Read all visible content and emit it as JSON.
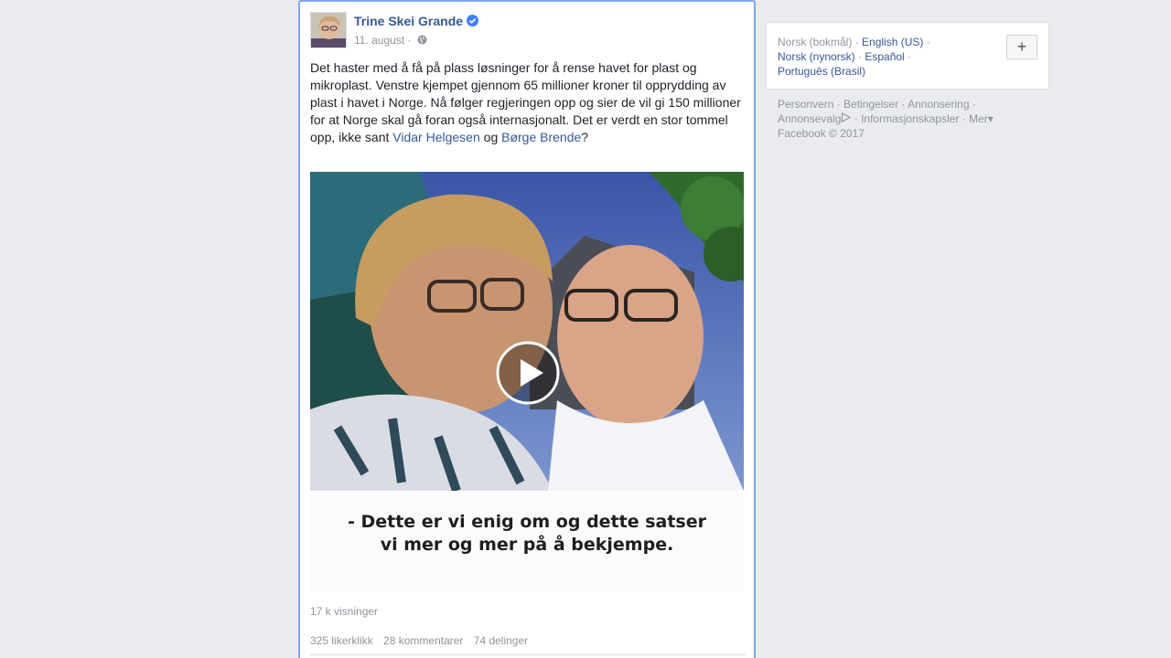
{
  "post": {
    "author": "Trine Skei Grande",
    "date": "11. august",
    "meta_separator": " · ",
    "body_text": "Det haster med å få på plass løsninger for å rense havet for plast og mikroplast. Venstre kjempet gjennom 65 millioner kroner til opprydding av plast i havet i Norge. Nå følger regjeringen opp og sier de vil gi 150 millioner for at Norge skal gå foran også internasjonalt. Det er verdt en stor tommel opp, ikke sant ",
    "mention_1": "Vidar Helgesen",
    "connector": " og ",
    "mention_2": "Børge Brende",
    "end_punct": "?",
    "video": {
      "caption_line1": "- Dette er vi enig om og dette satser",
      "caption_line2": "vi mer og mer på å bekjempe."
    },
    "views": "17 k visninger",
    "likes": "325 likerklikk",
    "comments": "28 kommentarer",
    "shares": "74 delinger"
  },
  "languages": {
    "current": "Norsk (bokmål)",
    "items": [
      "English (US)",
      "Norsk (nynorsk)",
      "Español",
      "Português (Brasil)"
    ],
    "add_button": "+"
  },
  "footer": {
    "links": [
      "Personvern",
      "Betingelser",
      "Annonsering",
      "Annonsevalg",
      "Informasjonskapsler",
      "Mer"
    ],
    "copyright": "Facebook © 2017"
  },
  "colors": {
    "link": "#365899",
    "muted": "#90949c",
    "background": "#e9ebee",
    "focus_border": "#7fa7e9"
  }
}
